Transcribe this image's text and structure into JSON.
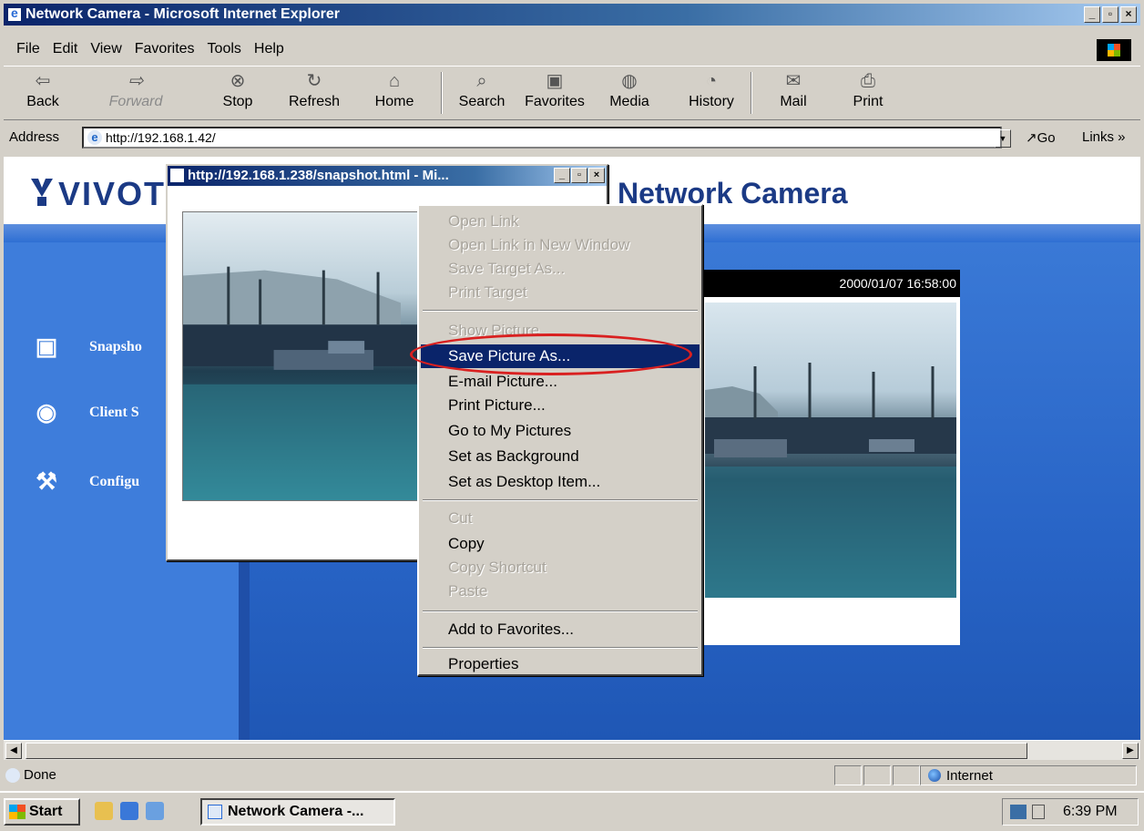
{
  "window": {
    "title": "Network Camera - Microsoft Internet Explorer"
  },
  "menu": [
    "File",
    "Edit",
    "View",
    "Favorites",
    "Tools",
    "Help"
  ],
  "toolbar": {
    "back": "Back",
    "forward": "Forward",
    "stop": "Stop",
    "refresh": "Refresh",
    "home": "Home",
    "search": "Search",
    "favorites": "Favorites",
    "media": "Media",
    "history": "History",
    "mail": "Mail",
    "print": "Print"
  },
  "address": {
    "label": "Address",
    "url": "http://192.168.1.42/",
    "go": "Go",
    "links": "Links »"
  },
  "page": {
    "logo": "VIVOT",
    "title": "Network Camera",
    "nav": [
      "Snapsho",
      "Client S",
      "Configu"
    ],
    "camera_timestamp": "2000/01/07 16:58:00"
  },
  "popup": {
    "title": "http://192.168.1.238/snapshot.html - Mi..."
  },
  "context_menu": {
    "open_link": "Open Link",
    "open_link_new_window": "Open Link in New Window",
    "save_target_as": "Save Target As...",
    "print_target": "Print Target",
    "show_picture": "Show Picture",
    "save_picture_as": "Save Picture As...",
    "email_picture": "E-mail Picture...",
    "print_picture": "Print Picture...",
    "go_to_my_pictures": "Go to My Pictures",
    "set_as_background": "Set as Background",
    "set_as_desktop_item": "Set as Desktop Item...",
    "cut": "Cut",
    "copy": "Copy",
    "copy_shortcut": "Copy Shortcut",
    "paste": "Paste",
    "add_to_favorites": "Add to Favorites...",
    "properties": "Properties"
  },
  "status": {
    "text": "Done",
    "zone": "Internet"
  },
  "taskbar": {
    "start": "Start",
    "task": "Network Camera -...",
    "clock": "6:39 PM"
  }
}
